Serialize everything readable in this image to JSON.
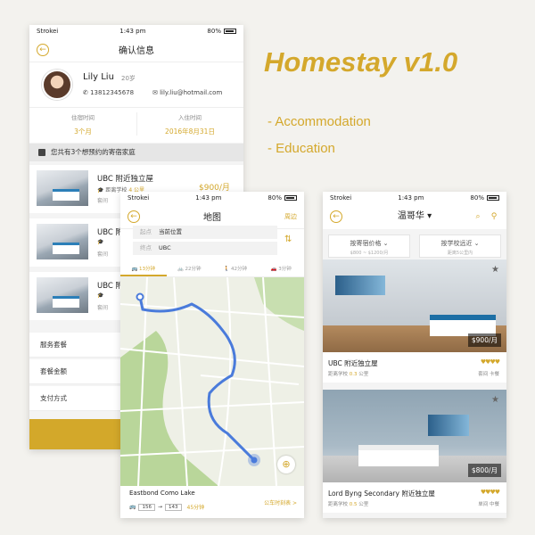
{
  "headline": "Homestay v1.0",
  "bullets": [
    "- Accommodation",
    "- Education"
  ],
  "accent_color": "#d4a82c",
  "status_bar": {
    "carrier": "Strokei",
    "time": "1:43 pm",
    "battery": "80%"
  },
  "confirm": {
    "title": "确认信息",
    "user": {
      "name": "Lily Liu",
      "age": "20岁",
      "phone": "13812345678",
      "email": "lily.liu@hotmail.com"
    },
    "stay_label": "住宿时间",
    "stay_value": "3个月",
    "checkin_label": "入住时间",
    "checkin_value": "2016年8月31日",
    "banner": "您共有3个想预约的寄宿家庭",
    "homes": [
      {
        "title": "UBC 附近独立屋",
        "sub": "距离学校",
        "dist": "4 公里",
        "note": "套间",
        "price": "$900/月"
      },
      {
        "title": "UBC 附",
        "sub": "",
        "dist": "",
        "note": "套间",
        "price": ""
      },
      {
        "title": "UBC 附",
        "sub": "",
        "dist": "",
        "note": "套间",
        "price": ""
      }
    ],
    "menu": [
      "服务套餐",
      "套餐金额",
      "支付方式"
    ]
  },
  "map": {
    "title": "地图",
    "right_action": "周边",
    "from_label": "起点",
    "from_value": "当前位置",
    "to_label": "终点",
    "to_value": "UBC",
    "modes": [
      "13分钟",
      "22分钟",
      "42分钟",
      "3分钟"
    ],
    "result_title": "Eastbond Como Lake",
    "bus1": "156",
    "bus2": "143",
    "duration": "45分钟",
    "schedule": "公车时刻表 >"
  },
  "list": {
    "city": "温哥华",
    "filter1": {
      "label": "按寄宿价格",
      "sub": "$800 ~ $1200/月"
    },
    "filter2": {
      "label": "按学校远近",
      "sub": "距离5公里内"
    },
    "listings": [
      {
        "price": "$900/月",
        "title": "UBC 附近独立屋",
        "dist_label": "距离学校",
        "dist": "0.3",
        "unit": "公里",
        "stars": "♥♥♥♥",
        "tags": "套间   卡餐"
      },
      {
        "price": "$800/月",
        "title": "Lord Byng Secondary 附近独立屋",
        "dist_label": "距离学校",
        "dist": "0.5",
        "unit": "公里",
        "stars": "♥♥♥♥",
        "tags": "单间   中餐"
      }
    ]
  }
}
